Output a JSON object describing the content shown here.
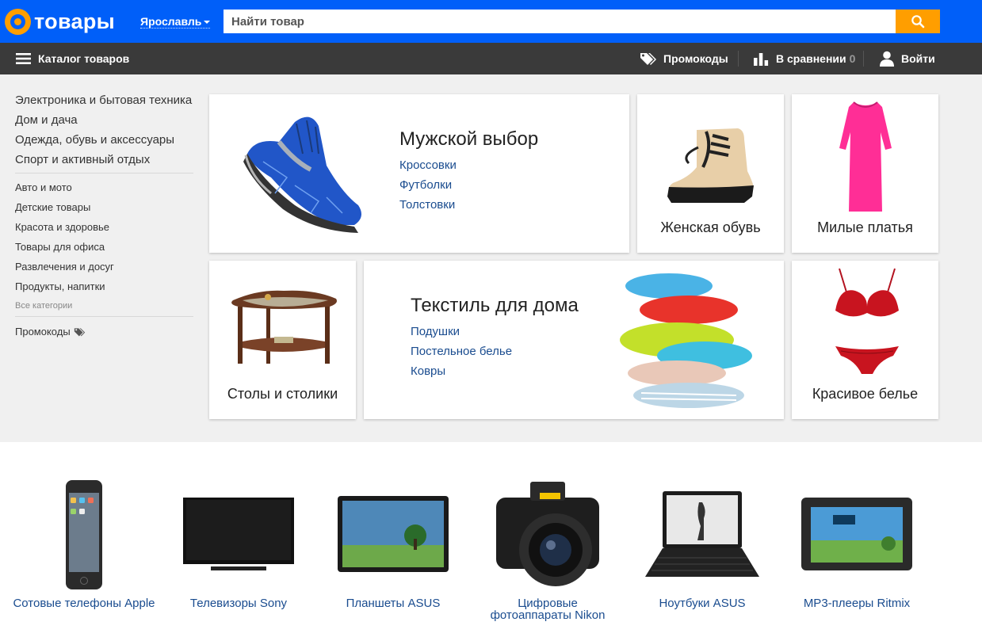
{
  "header": {
    "logo_text": "товары",
    "city": "Ярославль",
    "search_placeholder": "Найти товар"
  },
  "navbar": {
    "catalog": "Каталог товаров",
    "promo": "Промокоды",
    "compare": "В сравнении",
    "compare_count": "0",
    "login": "Войти"
  },
  "sidebar": {
    "main_categories": [
      "Электроника и бытовая техника",
      "Дом и дача",
      "Одежда, обувь и аксессуары",
      "Спорт и активный отдых"
    ],
    "sub_categories": [
      "Авто и мото",
      "Детские товары",
      "Красота и здоровье",
      "Товары для офиса",
      "Развлечения и досуг",
      "Продукты, напитки"
    ],
    "all_categories": "Все категории",
    "promo": "Промокоды"
  },
  "cards": {
    "mens": {
      "title": "Мужской выбор",
      "links": [
        "Кроссовки",
        "Футболки",
        "Толстовки"
      ]
    },
    "womens_shoes": {
      "caption": "Женская обувь"
    },
    "dresses": {
      "caption": "Милые платья"
    },
    "tables": {
      "caption": "Столы и столики"
    },
    "textile": {
      "title": "Текстиль для дома",
      "links": [
        "Подушки",
        "Постельное белье",
        "Ковры"
      ]
    },
    "lingerie": {
      "caption": "Красивое белье"
    }
  },
  "products": [
    {
      "label": "Сотовые телефоны Apple"
    },
    {
      "label": "Телевизоры Sony"
    },
    {
      "label": "Планшеты ASUS"
    },
    {
      "label": "Цифровые фотоаппараты Nikon"
    },
    {
      "label": "Ноутбуки ASUS"
    },
    {
      "label": "MP3-плееры Ritmix"
    }
  ],
  "colors": {
    "brand_blue": "#005ff9",
    "brand_orange": "#ff9e00",
    "nav_bg": "#3a3a3a",
    "link": "#1a4c8f"
  }
}
